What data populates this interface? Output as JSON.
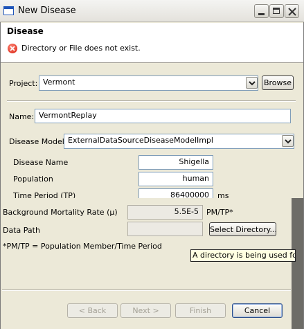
{
  "window": {
    "title": "New Disease"
  },
  "header": {
    "title": "Disease",
    "error_message": "Directory or File does not exist."
  },
  "project": {
    "label": "Project:",
    "value": "Vermont",
    "browse_label": "Browse"
  },
  "name": {
    "label": "Name:",
    "value": "VermontReplay"
  },
  "disease_model": {
    "label": "Disease Model:",
    "value": "ExternalDataSourceDiseaseModelImpl"
  },
  "params": {
    "disease_name_label": "Disease Name",
    "disease_name_value": "Shigella",
    "population_label": "Population",
    "population_value": "human",
    "time_period_label": "Time Period (TP)",
    "time_period_value": "86400000",
    "time_period_unit": "ms"
  },
  "lower": {
    "mortality_label": "Background Mortality Rate (µ)",
    "mortality_value": "5.5E-5",
    "mortality_unit": "PM/TP*",
    "data_path_label": "Data Path",
    "data_path_value": "",
    "select_directory_label": "Select Directory...",
    "footnote": "*PM/TP = Population Member/Time Period",
    "tooltip": "A directory is being used for lo"
  },
  "buttons": {
    "back": "< Back",
    "next": "Next >",
    "finish": "Finish",
    "cancel": "Cancel"
  }
}
